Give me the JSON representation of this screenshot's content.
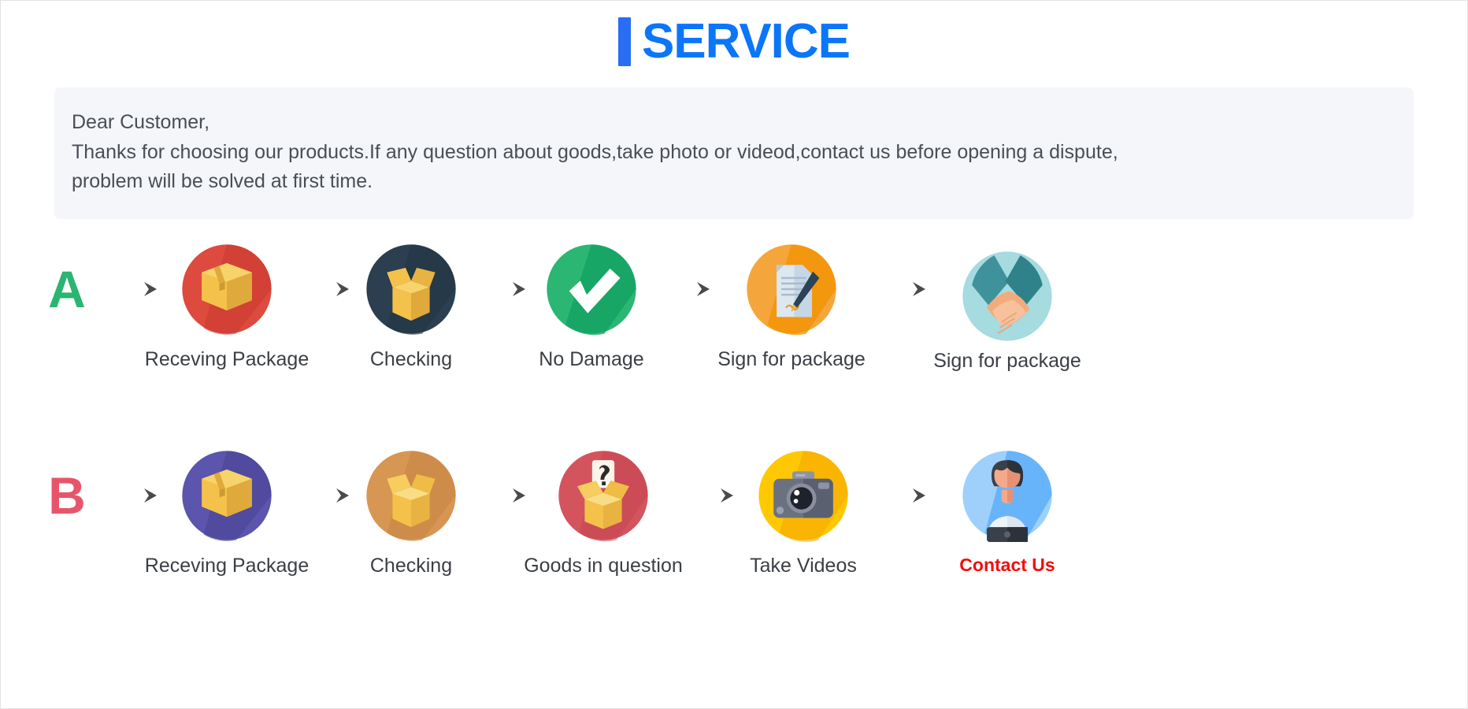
{
  "header": {
    "accent_bar_color": "#2a6df5",
    "title": "SERVICE",
    "title_color": "#0b76f8"
  },
  "notice": {
    "background_color": "#f4f6fa",
    "lines": [
      "Dear Customer,",
      "Thanks for choosing our products.If any question about goods,take photo or videod,contact us before opening a dispute,",
      "problem will be solved at first time."
    ]
  },
  "flow": {
    "arrow_icon": "arrow-right-icon",
    "rows": [
      {
        "letter": "A",
        "letter_color": "#2ab573",
        "steps": [
          {
            "label": "Receving Package",
            "icon": "closed-package-box-icon",
            "circle_color": "#dd4b3e"
          },
          {
            "label": "Checking",
            "icon": "open-package-box-icon",
            "circle_color": "#2b3f51"
          },
          {
            "label": "No Damage",
            "icon": "check-mark-icon",
            "circle_color": "#2bb673"
          },
          {
            "label": "Sign for package",
            "icon": "document-signing-icon",
            "circle_color": "#f5a63b"
          },
          {
            "label": "Sign for package",
            "icon": "handshake-icon",
            "circle_color": "#a6dbe0"
          }
        ]
      },
      {
        "letter": "B",
        "letter_color": "#e8556b",
        "steps": [
          {
            "label": "Receving Package",
            "icon": "closed-package-box-icon",
            "circle_color": "#5b55ad"
          },
          {
            "label": "Checking",
            "icon": "open-package-box-icon",
            "circle_color": "#d79652"
          },
          {
            "label": "Goods in question",
            "icon": "question-box-icon",
            "circle_color": "#d4545e"
          },
          {
            "label": "Take Videos",
            "icon": "camera-icon",
            "circle_color": "#ffc803"
          },
          {
            "label": "Contact Us",
            "icon": "support-agent-icon",
            "circle_color": "#9ed0fb",
            "label_accent": true,
            "label_color": "#f50c0c"
          }
        ]
      }
    ]
  }
}
